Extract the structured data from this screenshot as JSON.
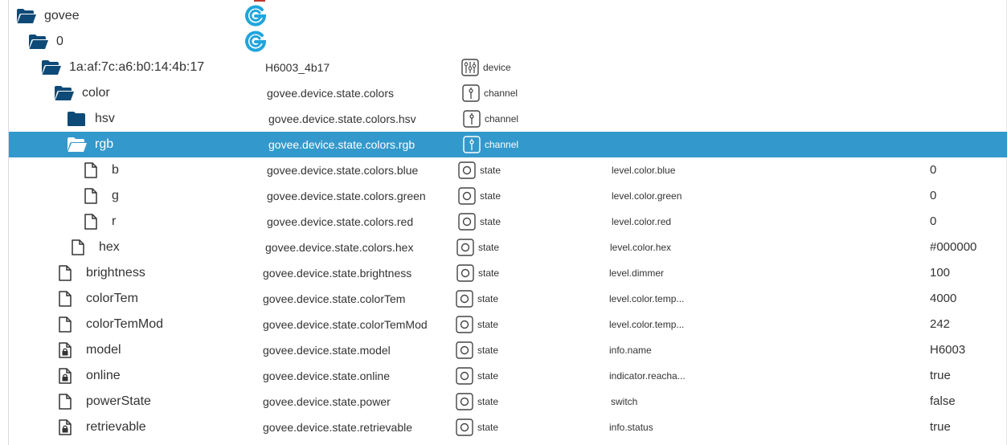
{
  "accent_color": "#3399cc",
  "logo_color": "#20a5dd",
  "rows": [
    {
      "label": "govee",
      "name": "",
      "type": "",
      "role": "",
      "value": "",
      "icon": "folder-open-icon",
      "logo": true
    },
    {
      "label": "0",
      "name": "",
      "type": "",
      "role": "",
      "value": "",
      "icon": "folder-open-icon",
      "logo": true
    },
    {
      "label": "1a:af:7c:a6:b0:14:4b:17",
      "name": "H6003_4b17",
      "type": "device",
      "role": "",
      "value": "",
      "icon": "folder-open-icon",
      "typeIcon": "device-icon"
    },
    {
      "label": "color",
      "name": "govee.device.state.colors",
      "type": "channel",
      "role": "",
      "value": "",
      "icon": "folder-open-icon",
      "typeIcon": "channel-icon"
    },
    {
      "label": "hsv",
      "name": "govee.device.state.colors.hsv",
      "type": "channel",
      "role": "",
      "value": "",
      "icon": "folder-closed-icon",
      "typeIcon": "channel-icon"
    },
    {
      "label": "rgb",
      "name": "govee.device.state.colors.rgb",
      "type": "channel",
      "role": "",
      "value": "",
      "icon": "folder-open-icon",
      "typeIcon": "channel-icon",
      "selected": true
    },
    {
      "label": "b",
      "name": "govee.device.state.colors.blue",
      "type": "state",
      "role": "level.color.blue",
      "value": "0",
      "icon": "file-icon",
      "typeIcon": "state-icon"
    },
    {
      "label": "g",
      "name": "govee.device.state.colors.green",
      "type": "state",
      "role": "level.color.green",
      "value": "0",
      "icon": "file-icon",
      "typeIcon": "state-icon"
    },
    {
      "label": "r",
      "name": "govee.device.state.colors.red",
      "type": "state",
      "role": "level.color.red",
      "value": "0",
      "icon": "file-icon",
      "typeIcon": "state-icon"
    },
    {
      "label": "hex",
      "name": "govee.device.state.colors.hex",
      "type": "state",
      "role": "level.color.hex",
      "value": "#000000",
      "icon": "file-icon",
      "typeIcon": "state-icon"
    },
    {
      "label": "brightness",
      "name": "govee.device.state.brightness",
      "type": "state",
      "role": "level.dimmer",
      "value": "100",
      "icon": "file-icon",
      "typeIcon": "state-icon"
    },
    {
      "label": "colorTem",
      "name": "govee.device.state.colorTem",
      "type": "state",
      "role": "level.color.temp...",
      "value": "4000",
      "icon": "file-icon",
      "typeIcon": "state-icon"
    },
    {
      "label": "colorTemMod",
      "name": "govee.device.state.colorTemMod",
      "type": "state",
      "role": "level.color.temp...",
      "value": "242",
      "icon": "file-icon",
      "typeIcon": "state-icon"
    },
    {
      "label": "model",
      "name": "govee.device.state.model",
      "type": "state",
      "role": "info.name",
      "value": "H6003",
      "icon": "file-lock-icon",
      "typeIcon": "state-icon"
    },
    {
      "label": "online",
      "name": "govee.device.state.online",
      "type": "state",
      "role": "indicator.reacha...",
      "value": "true",
      "icon": "file-lock-icon",
      "typeIcon": "state-icon"
    },
    {
      "label": "powerState",
      "name": "govee.device.state.power",
      "type": "state",
      "role": "switch",
      "value": "false",
      "icon": "file-icon",
      "typeIcon": "state-icon"
    },
    {
      "label": "retrievable",
      "name": "govee.device.state.retrievable",
      "type": "state",
      "role": "info.status",
      "value": "true",
      "icon": "file-lock-icon",
      "typeIcon": "state-icon"
    }
  ]
}
